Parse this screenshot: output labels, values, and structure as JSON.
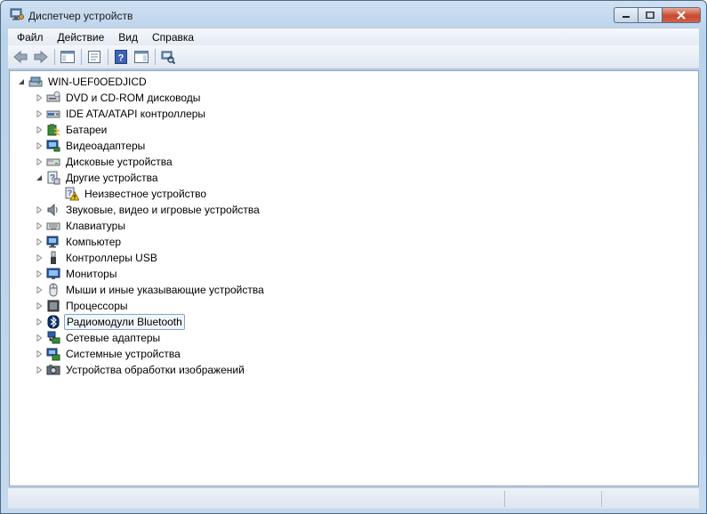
{
  "window": {
    "title": "Диспетчер устройств",
    "icon": "device-manager-icon"
  },
  "menu": [
    "Файл",
    "Действие",
    "Вид",
    "Справка"
  ],
  "toolbar": {
    "buttons": [
      "back-arrow-icon",
      "forward-arrow-icon",
      "show-hide-console-tree-icon",
      "properties-icon",
      "help-icon",
      "action-pane-icon",
      "scan-hardware-icon"
    ]
  },
  "tree": {
    "root": "WIN-UEF0OEDJICD",
    "items": [
      {
        "label": "DVD и CD-ROM дисководы",
        "icon": "dvd-drive-icon"
      },
      {
        "label": "IDE ATA/ATAPI контроллеры",
        "icon": "ide-controller-icon"
      },
      {
        "label": "Батареи",
        "icon": "battery-icon"
      },
      {
        "label": "Видеоадаптеры",
        "icon": "display-adapter-icon"
      },
      {
        "label": "Дисковые устройства",
        "icon": "disk-drive-icon"
      },
      {
        "label": "Другие устройства",
        "icon": "other-devices-icon",
        "expanded": true,
        "children": [
          {
            "label": "Неизвестное устройство",
            "icon": "unknown-device-warning-icon"
          }
        ]
      },
      {
        "label": "Звуковые, видео и игровые устройства",
        "icon": "sound-icon"
      },
      {
        "label": "Клавиатуры",
        "icon": "keyboard-icon"
      },
      {
        "label": "Компьютер",
        "icon": "computer-icon"
      },
      {
        "label": "Контроллеры USB",
        "icon": "usb-icon"
      },
      {
        "label": "Мониторы",
        "icon": "monitor-icon"
      },
      {
        "label": "Мыши и иные указывающие устройства",
        "icon": "mouse-icon"
      },
      {
        "label": "Процессоры",
        "icon": "processor-icon"
      },
      {
        "label": "Радиомодули Bluetooth",
        "icon": "bluetooth-icon",
        "selected": true
      },
      {
        "label": "Сетевые адаптеры",
        "icon": "network-adapter-icon"
      },
      {
        "label": "Системные устройства",
        "icon": "system-devices-icon"
      },
      {
        "label": "Устройства обработки изображений",
        "icon": "imaging-device-icon"
      }
    ]
  },
  "colors": {
    "accent": "#7da2ce",
    "window_frame": "#b9d1ea",
    "close_button": "#c74a30"
  }
}
